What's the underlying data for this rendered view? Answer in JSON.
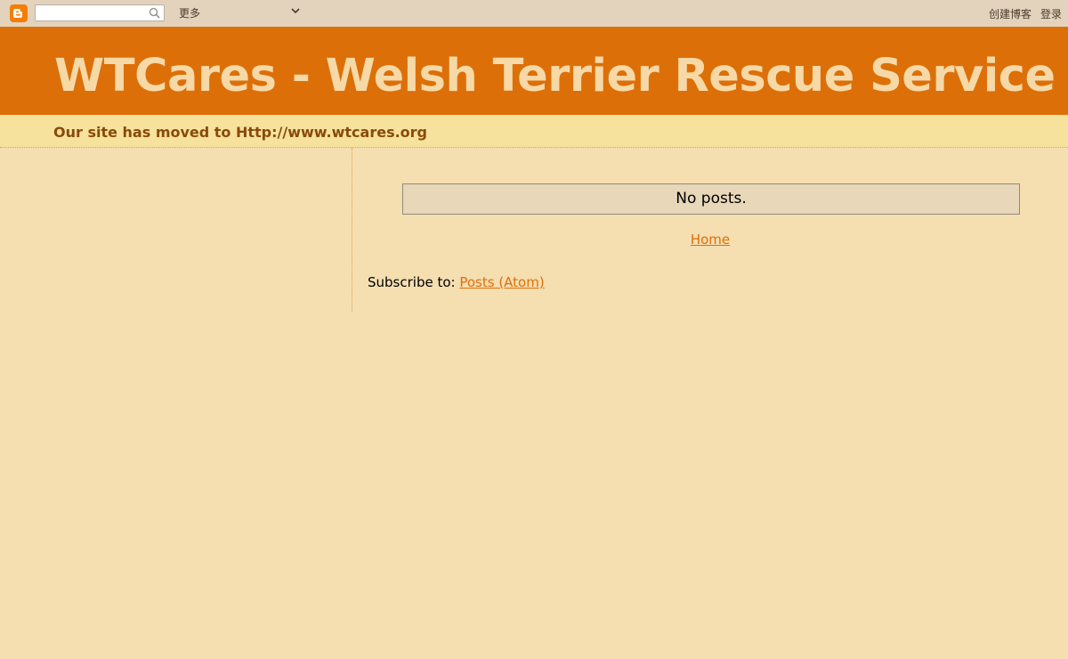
{
  "navbar": {
    "search_value": "",
    "more_label": "更多",
    "create_blog_label": "创建博客",
    "login_label": "登录"
  },
  "header": {
    "title": "WTCares - Welsh Terrier Rescue Service",
    "description": "Our site has moved to Http://www.wtcares.org"
  },
  "main": {
    "no_posts": "No posts.",
    "home_link": "Home",
    "subscribe_label": "Subscribe to:",
    "subscribe_link": "Posts (Atom)"
  },
  "colors": {
    "page_bg": "#f5deb0",
    "header_bg": "#dd6f08",
    "title_text": "#f6d9a6",
    "desc_bar_bg": "#f6e29c",
    "link": "#dd6f08"
  }
}
